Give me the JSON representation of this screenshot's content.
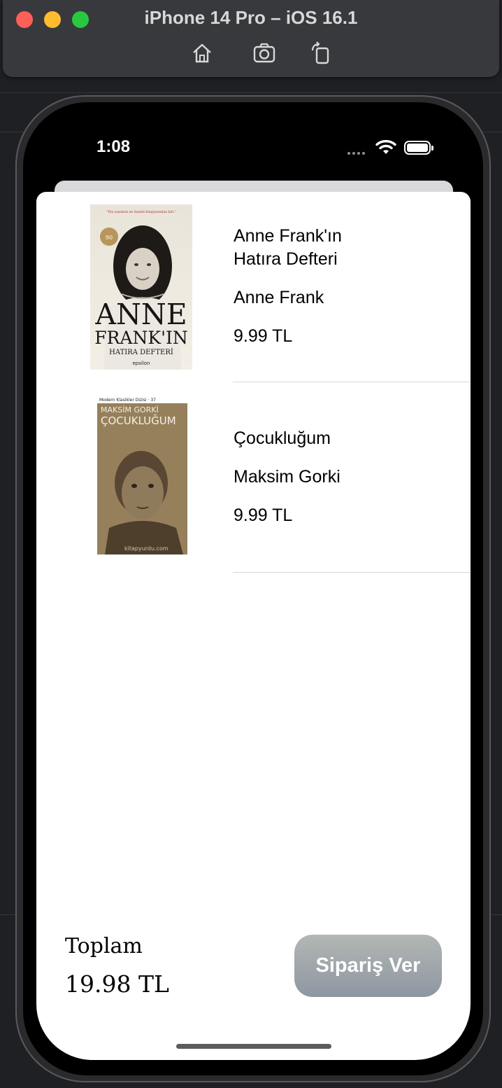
{
  "simulator": {
    "title": "iPhone 14 Pro – iOS 16.1",
    "toolbar_icons": [
      "home-icon",
      "screenshot-icon",
      "rotate-icon"
    ]
  },
  "status_bar": {
    "time": "1:08"
  },
  "cart": {
    "items": [
      {
        "title": "Anne Frank'ın Hatıra Defteri",
        "author": "Anne Frank",
        "price": "9.99 TL",
        "cover": {
          "top_tagline": "\"Yüz yazıların en önemli kitaplarından biri.\"",
          "badge": "90",
          "title_line1": "ANNE",
          "title_line2": "FRANK'IN",
          "subtitle": "HATIRA DEFTERİ",
          "publisher": "epsilon"
        }
      },
      {
        "title": "Çocukluğum",
        "author": "Maksim Gorki",
        "price": "9.99 TL",
        "cover": {
          "series": "Modern Klasikler Dizisi · 37",
          "author": "MAKSİM GORKİ",
          "title": "ÇOCUKLUĞUM",
          "watermark": "kitapyurdu.com"
        }
      }
    ],
    "total_label": "Toplam",
    "total_value": "19.98 TL",
    "order_button": "Sipariş Ver"
  },
  "colors": {
    "order_button_top": "#b3b7b4",
    "order_button_bottom": "#8d97a2",
    "sheet": "#ffffff",
    "background": "#1f2024"
  }
}
